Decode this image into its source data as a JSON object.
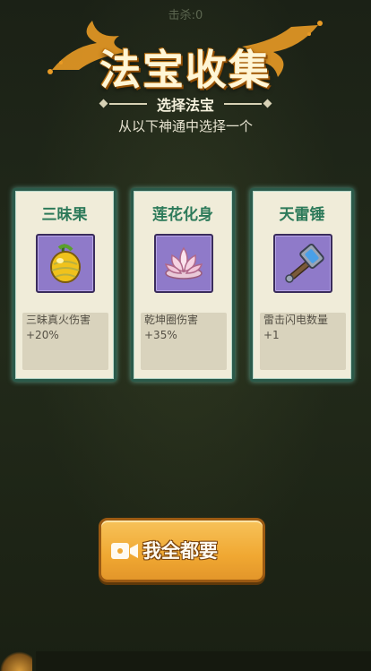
{
  "hud": {
    "kills_text": "击杀:0"
  },
  "header": {
    "title": "法宝收集",
    "subtitle": "选择法宝",
    "instruction": "从以下神通中选择一个"
  },
  "cards": [
    {
      "name": "三昧果",
      "icon": "golden-fruit-icon",
      "description": "三昧真火伤害+20%"
    },
    {
      "name": "莲花化身",
      "icon": "lotus-flower-icon",
      "description": "乾坤圈伤害+35%"
    },
    {
      "name": "天雷锤",
      "icon": "thunder-hammer-icon",
      "description": "雷击闪电数量+1"
    }
  ],
  "cta": {
    "label": "我全都要",
    "icon": "video-ad-icon"
  },
  "colors": {
    "title": "#fff6d6",
    "card_border": "#2b5a4a",
    "card_name": "#2d7a5a",
    "icon_bg": "#8f7ac9",
    "button": "#f0a832"
  }
}
